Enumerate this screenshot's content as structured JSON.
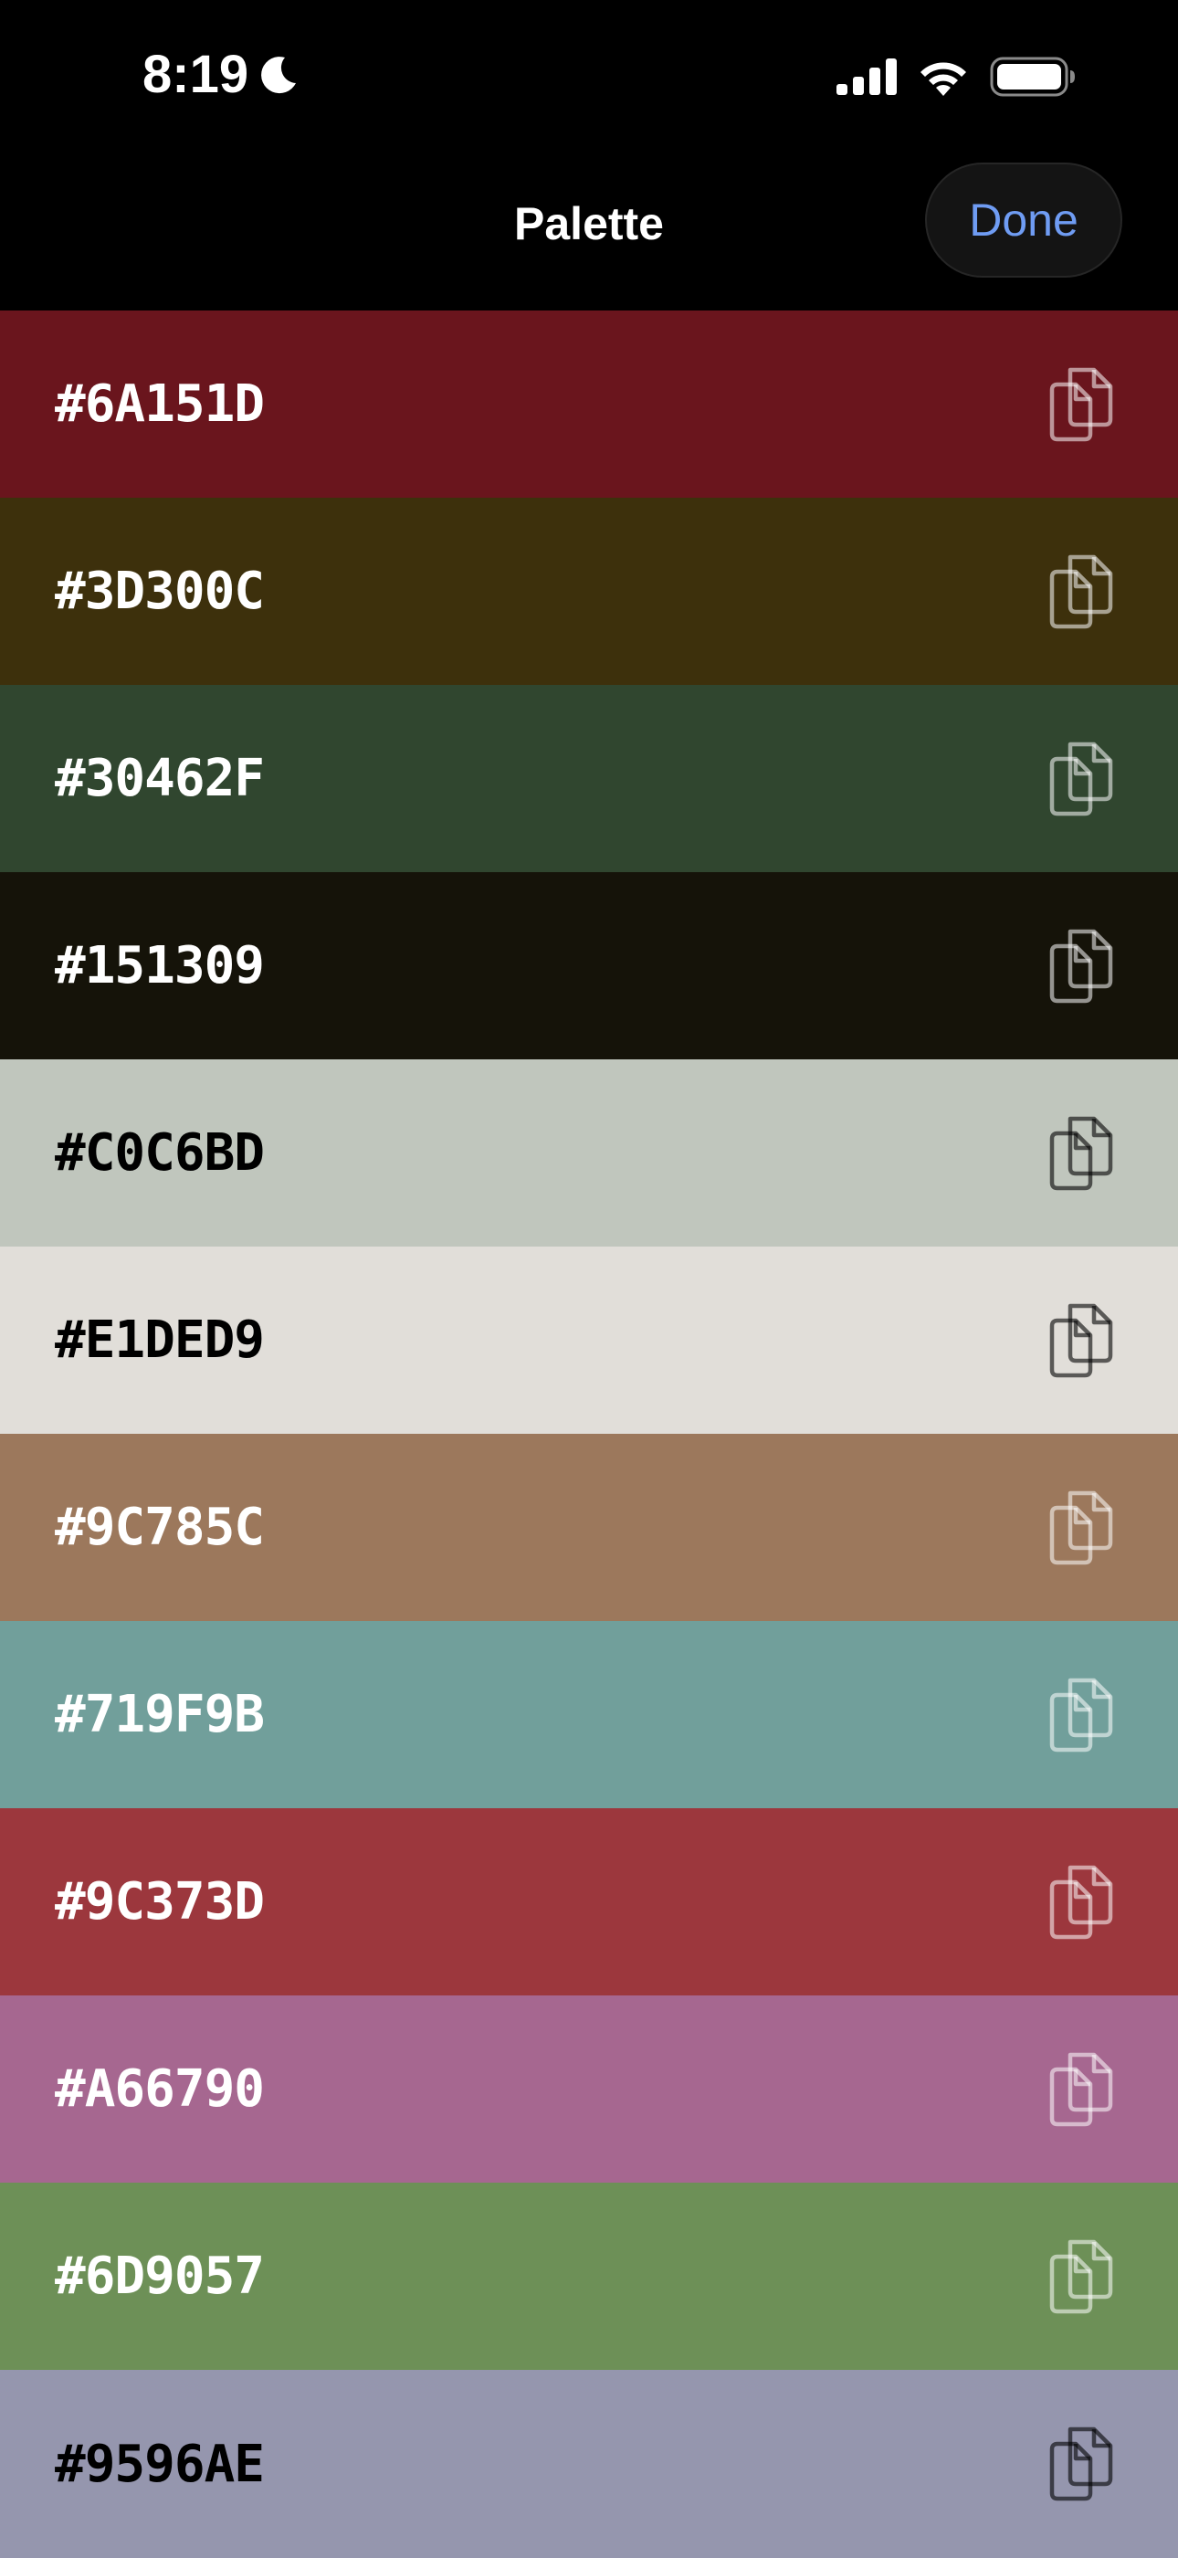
{
  "status_bar": {
    "time": "8:19",
    "focus_icon": "moon-icon",
    "signal_icon": "cellular-signal-icon",
    "wifi_icon": "wifi-icon",
    "battery_icon": "battery-icon"
  },
  "nav": {
    "title": "Palette",
    "done_label": "Done",
    "done_color": "#6f9cf3"
  },
  "palette": [
    {
      "hex": "#6A151D",
      "color": "#6A151D",
      "text": "light",
      "copy_icon": "copy-icon"
    },
    {
      "hex": "#3D300C",
      "color": "#3D300C",
      "text": "light",
      "copy_icon": "copy-icon"
    },
    {
      "hex": "#30462F",
      "color": "#30462F",
      "text": "light",
      "copy_icon": "copy-icon"
    },
    {
      "hex": "#151309",
      "color": "#151309",
      "text": "light",
      "copy_icon": "copy-icon"
    },
    {
      "hex": "#C0C6BD",
      "color": "#C0C6BD",
      "text": "dark",
      "copy_icon": "copy-icon"
    },
    {
      "hex": "#E1DED9",
      "color": "#E1DED9",
      "text": "dark",
      "copy_icon": "copy-icon"
    },
    {
      "hex": "#9C785C",
      "color": "#9C785C",
      "text": "light",
      "copy_icon": "copy-icon"
    },
    {
      "hex": "#719F9B",
      "color": "#719F9B",
      "text": "light",
      "copy_icon": "copy-icon"
    },
    {
      "hex": "#9C373D",
      "color": "#9C373D",
      "text": "light",
      "copy_icon": "copy-icon"
    },
    {
      "hex": "#A66790",
      "color": "#A66790",
      "text": "light",
      "copy_icon": "copy-icon"
    },
    {
      "hex": "#6D9057",
      "color": "#6D9057",
      "text": "light",
      "copy_icon": "copy-icon"
    },
    {
      "hex": "#9596AE",
      "color": "#9596AE",
      "text": "dark",
      "copy_icon": "copy-icon"
    }
  ]
}
